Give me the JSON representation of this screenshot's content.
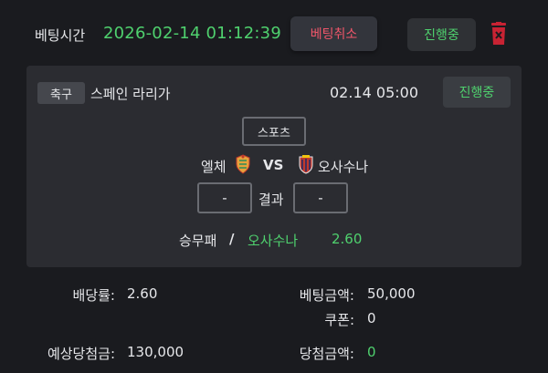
{
  "header": {
    "bet_time_label": "베팅시간",
    "bet_time_value": "2026-02-14 01:12:39",
    "cancel_label": "베팅취소",
    "status_label": "진행중",
    "trash_icon": "trash-icon"
  },
  "card": {
    "category": "축구",
    "league": "스페인 라리가",
    "match_time": "02.14 05:00",
    "status_label": "진행중",
    "sport_label": "스포츠",
    "home_team": "엘체",
    "vs_label": "VS",
    "away_team": "오사수나",
    "home_score": "-",
    "result_label": "결과",
    "away_score": "-",
    "bet_type": "승무패",
    "separator": "/",
    "pick": "오사수나",
    "odds": "2.60"
  },
  "summary": {
    "odds_label": "배당률:",
    "odds_value": "2.60",
    "bet_amount_label": "베팅금액:",
    "bet_amount_value": "50,000",
    "coupon_label": "쿠폰:",
    "coupon_value": "0",
    "expected_win_label": "예상당첨금:",
    "expected_win_value": "130,000",
    "win_amount_label": "당첨금액:",
    "win_amount_value": "0"
  },
  "colors": {
    "accent_green": "#4fd16e",
    "cancel_red": "#f0566a",
    "background": "#1a1b1f",
    "card": "#2b2c31"
  }
}
